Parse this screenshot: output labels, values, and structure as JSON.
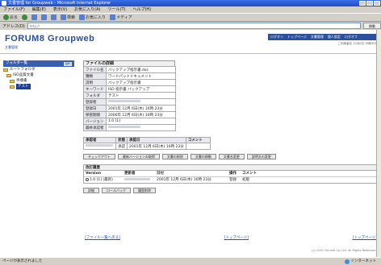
{
  "window": {
    "title": "文書管理 for Groupweb - Microsoft Internet Explorer"
  },
  "menu": [
    "ファイル(F)",
    "編集(E)",
    "表示(V)",
    "お気に入り(A)",
    "ツール(T)",
    "ヘルプ(H)"
  ],
  "toolbar": {
    "back": "戻る",
    "search": "検索",
    "favorites": "お気に入り",
    "media": "メディア"
  },
  "address": {
    "label": "アドレス(D)",
    "value": "http://",
    "go": "移動"
  },
  "app": {
    "brand": "FORUM8 Groupweb",
    "subtitle": "文書管理"
  },
  "nav": {
    "links": [
      "ログオン",
      "トップページ",
      "文書管理",
      "個人設定",
      "ログオフ"
    ],
    "info": "ご利用者名 12月0日 19時30分"
  },
  "sidebar": {
    "title": "フォルダ一覧",
    "mini": "操作",
    "items": [
      "ルートフォルダ",
      "ISO品質文書",
      "手順書",
      "テスト"
    ]
  },
  "detail": {
    "title": "ファイルの詳細",
    "rows": [
      {
        "label": "ファイル名",
        "value": "バックアップ指示書.doc"
      },
      {
        "label": "種類",
        "value": "ワードパッドドキュメント"
      },
      {
        "label": "説明",
        "value": "バックアップ指示書"
      },
      {
        "label": "キーワード",
        "value": "ISO 指示書 バックアップ"
      },
      {
        "label": "フォルダ",
        "value": "テスト"
      },
      {
        "label": "登録者",
        "value": ""
      },
      {
        "label": "登録日",
        "value": "2001年 12月 6日(木) 16時 23分"
      },
      {
        "label": "保管期間",
        "value": "2006年 12月 6日(水) 16時 23分"
      },
      {
        "label": "バージョン",
        "value": "1.0 [1]"
      },
      {
        "label": "最終承認者",
        "value": ""
      }
    ]
  },
  "approval": {
    "headers": [
      "承認者",
      "状態",
      "承認日",
      "コメント"
    ],
    "row": {
      "approver": "",
      "status": "承認",
      "date": "2001年 12月 6日(木) 16時 23分",
      "comment": ""
    }
  },
  "actions": [
    "チェックアウト",
    "最新バージョンの取得",
    "文書の削除",
    "文書の移動",
    "文書名変更",
    "説明文の変更"
  ],
  "history": {
    "title": "改訂履歴",
    "headers": [
      "Version",
      "更新者",
      "日付",
      "操作",
      "コメント"
    ],
    "row": {
      "version": "1.0 [1] (最新)",
      "user": "",
      "date": "2001年 12月 6日(木) 16時 23分",
      "op": "登録",
      "comment": "初版"
    },
    "buttons": [
      "詳細",
      "ロールバック",
      "履歴削除"
    ]
  },
  "footer": {
    "back_link": "[ファイル一覧へ戻る]",
    "top_link": "[トップページ]",
    "top_link2": "[トップページ]",
    "copyright": "(c) 2001 Forum8 Co.,Ltd. All Rights Reserved."
  },
  "status": {
    "left": "ページが表示されました",
    "zone": "インターネット"
  }
}
